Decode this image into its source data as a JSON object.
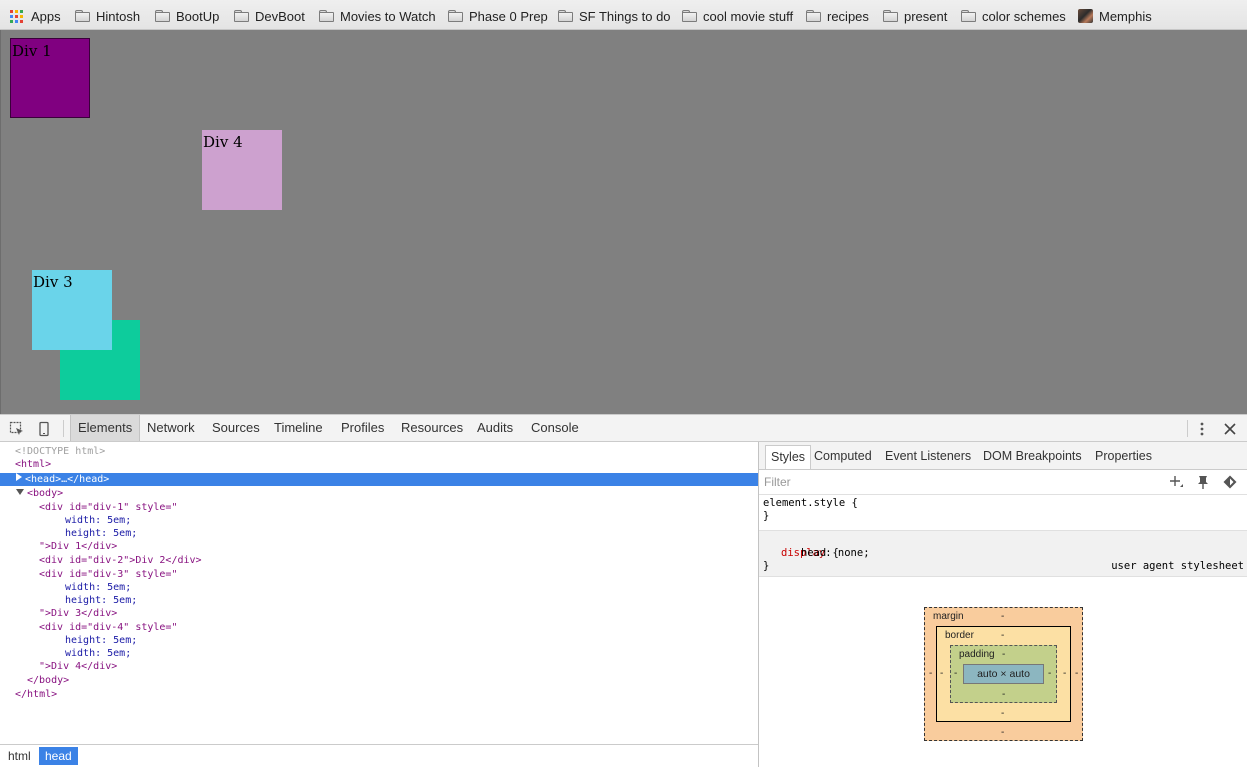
{
  "bookmarks": {
    "apps_label": "Apps",
    "items": [
      {
        "label": "Hintosh",
        "icon": "folder-icon"
      },
      {
        "label": "BootUp",
        "icon": "folder-icon"
      },
      {
        "label": "DevBoot",
        "icon": "folder-icon"
      },
      {
        "label": "Movies to Watch",
        "icon": "folder-icon"
      },
      {
        "label": "Phase 0 Prep",
        "icon": "folder-icon"
      },
      {
        "label": "SF Things to do",
        "icon": "folder-icon"
      },
      {
        "label": "cool movie stuff",
        "icon": "folder-icon"
      },
      {
        "label": "recipes",
        "icon": "folder-icon"
      },
      {
        "label": "present",
        "icon": "folder-icon"
      },
      {
        "label": "color schemes",
        "icon": "folder-icon"
      },
      {
        "label": "Memphis",
        "icon": "site-thumbnail-icon"
      }
    ]
  },
  "page": {
    "background": "#808080",
    "divs": [
      {
        "id": "div-1",
        "label": "Div 1",
        "color": "#800080"
      },
      {
        "id": "div-4",
        "label": "Div 4",
        "color": "#cda1cf"
      },
      {
        "id": "div-3",
        "label": "Div 3",
        "color": "#6ad4ea"
      },
      {
        "id": "div-2",
        "label": "",
        "color": "#0dcc9c"
      }
    ]
  },
  "devtools": {
    "tabs": [
      "Elements",
      "Network",
      "Sources",
      "Timeline",
      "Profiles",
      "Resources",
      "Audits",
      "Console"
    ],
    "active_tab": "Elements",
    "accent": "#3b82e6",
    "source": {
      "doctype": "<!DOCTYPE html>",
      "html_open": "<html>",
      "head": "<head>…</head>",
      "body_open": "<body>",
      "div1_open": "<div id=\"div-1\" style=\"",
      "div1_w": "width: 5em;",
      "div1_h": "height: 5em;",
      "div1_close": "\">Div 1</div>",
      "div2": "<div id=\"div-2\">Div 2</div>",
      "div3_open": "<div id=\"div-3\" style=\"",
      "div3_w": "width: 5em;",
      "div3_h": "height: 5em;",
      "div3_close": "\">Div 3</div>",
      "div4_open": "<div id=\"div-4\" style=\"",
      "div4_h": "height: 5em;",
      "div4_w": "width: 5em;",
      "div4_close": "\">Div 4</div>",
      "body_close": "</body>",
      "html_close": "</html>"
    },
    "breadcrumbs": [
      "html",
      "head"
    ],
    "active_breadcrumb": "head",
    "sidebar": {
      "tabs": [
        "Styles",
        "Computed",
        "Event Listeners",
        "DOM Breakpoints",
        "Properties"
      ],
      "active_tab": "Styles",
      "filter_placeholder": "Filter",
      "element_style_open": "element.style {",
      "element_style_close": "}",
      "head_rule_open": "head {",
      "head_rule_origin": "user agent stylesheet",
      "head_prop": "display",
      "head_value": ": none;",
      "head_rule_close": "}",
      "box_model": {
        "margin_label": "margin",
        "border_label": "border",
        "padding_label": "padding",
        "content": "auto × auto",
        "dash": "-"
      }
    }
  }
}
